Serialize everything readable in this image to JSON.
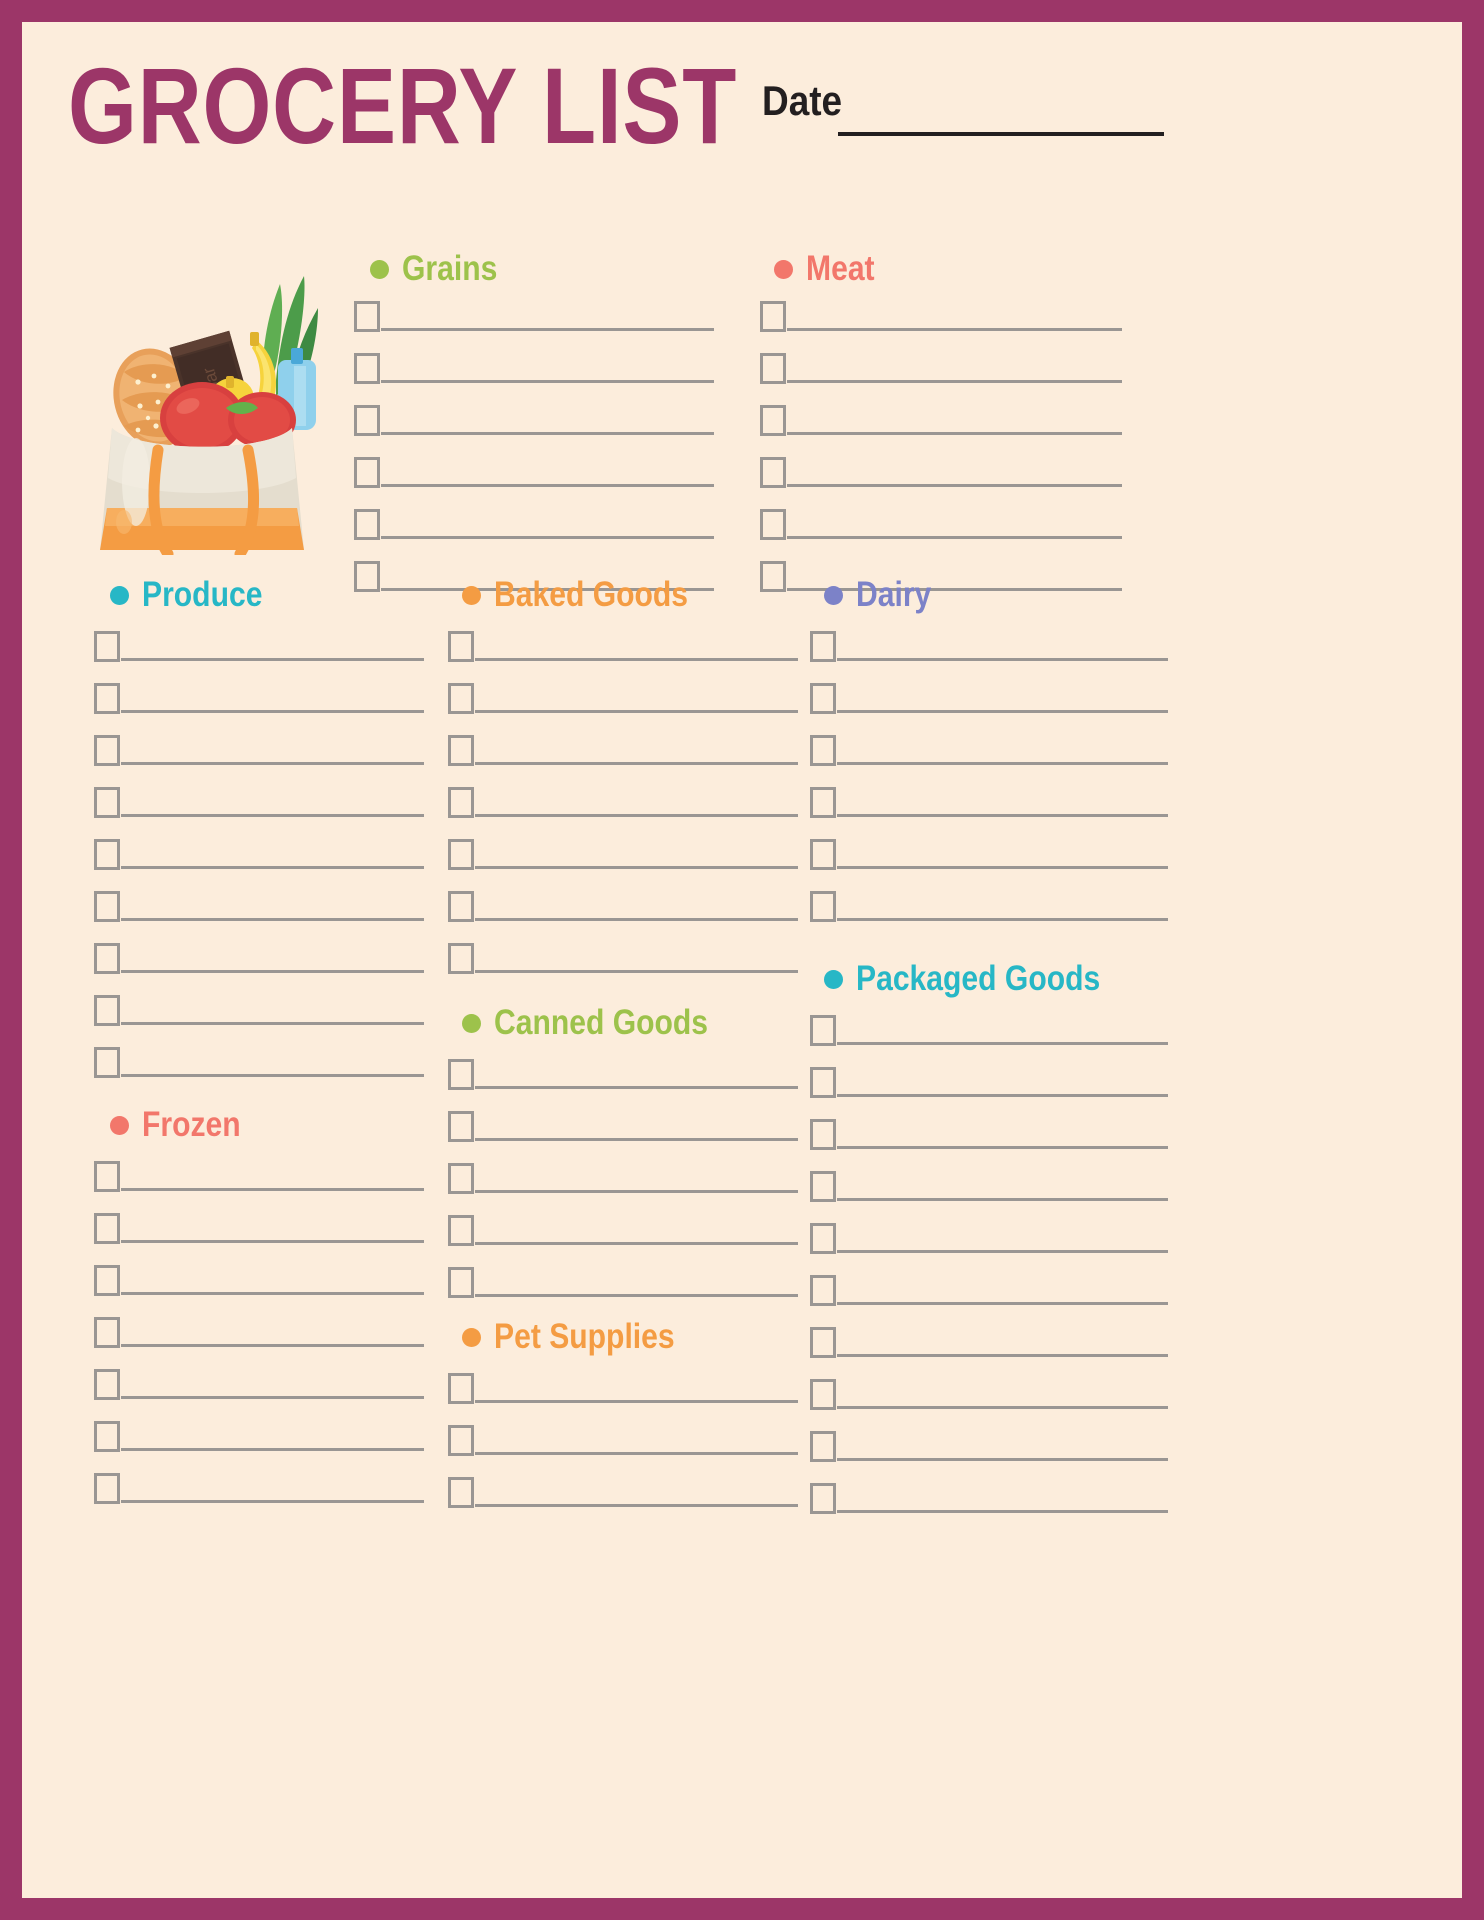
{
  "theme": {
    "border_color": "#9C3668",
    "page_background": "#FCEDDC",
    "title_color": "#9C3668",
    "text_dark": "#231F20",
    "rule_color": "#9A9693",
    "green": "#9DC24B",
    "salmon": "#F2776B",
    "cyan": "#27B7C6",
    "orange": "#F49C43",
    "periwinkle": "#7C82C8"
  },
  "header": {
    "title": "GROCERY LIST",
    "date_label": "Date",
    "date_value": ""
  },
  "illustration": {
    "name": "grocery-bag-illustration",
    "alt": "Cloth tote grocery bag with bread, chocolate, banana, apples, greens and a water bottle"
  },
  "sections": [
    {
      "id": "grains",
      "label": "Grains",
      "color": "#9DC24B",
      "rows": 6
    },
    {
      "id": "meat",
      "label": "Meat",
      "color": "#F2776B",
      "rows": 6
    },
    {
      "id": "produce",
      "label": "Produce",
      "color": "#27B7C6",
      "rows": 9
    },
    {
      "id": "baked-goods",
      "label": "Baked Goods",
      "color": "#F49C43",
      "rows": 7
    },
    {
      "id": "dairy",
      "label": "Dairy",
      "color": "#7C82C8",
      "rows": 6
    },
    {
      "id": "canned-goods",
      "label": "Canned Goods",
      "color": "#9DC24B",
      "rows": 5
    },
    {
      "id": "packaged-goods",
      "label": "Packaged Goods",
      "color": "#27B7C6",
      "rows": 10
    },
    {
      "id": "frozen",
      "label": "Frozen",
      "color": "#F2776B",
      "rows": 7
    },
    {
      "id": "pet-supplies",
      "label": "Pet Supplies",
      "color": "#F49C43",
      "rows": 3
    }
  ]
}
